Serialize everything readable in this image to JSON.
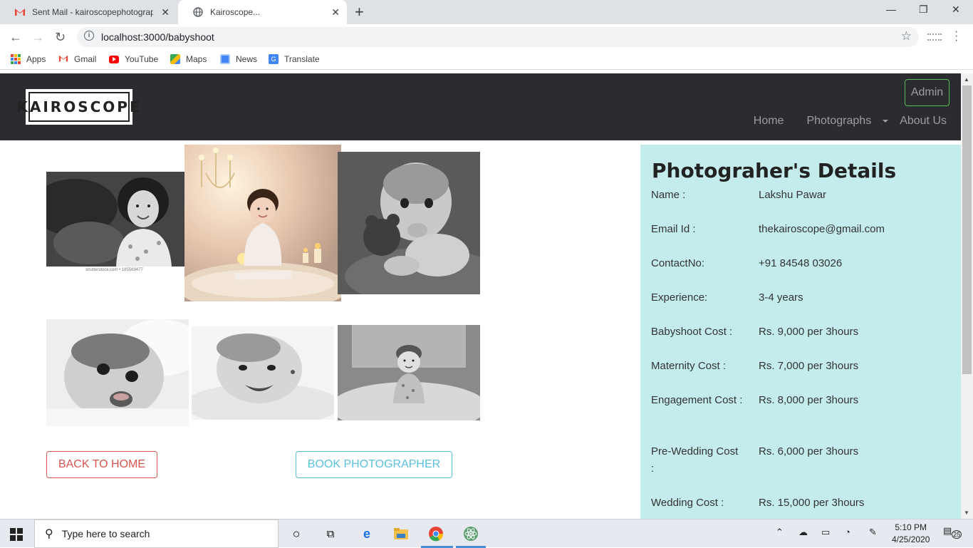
{
  "browser": {
    "tabs": [
      {
        "title": "Sent Mail - kairoscopephotographer",
        "icon": "gmail-icon"
      },
      {
        "title": "Kairoscope...",
        "icon": "globe-icon"
      }
    ],
    "url": "localhost:3000/babyshoot",
    "bookmarks": [
      {
        "label": "Apps",
        "icon": "apps-grid-icon",
        "color": "#ea4335"
      },
      {
        "label": "Gmail",
        "icon": "gmail-icon",
        "color": "#ea4335"
      },
      {
        "label": "YouTube",
        "icon": "youtube-icon",
        "color": "#ff0000"
      },
      {
        "label": "Maps",
        "icon": "maps-icon",
        "color": "#34a853"
      },
      {
        "label": "News",
        "icon": "news-icon",
        "color": "#4285f4"
      },
      {
        "label": "Translate",
        "icon": "translate-icon",
        "color": "#4285f4"
      }
    ]
  },
  "site": {
    "logo_text": "KAIROSCOPE",
    "admin_label": "Admin",
    "nav": {
      "home": "Home",
      "photographs": "Photographs",
      "about": "About Us"
    }
  },
  "gallery": {
    "photos": [
      {
        "alt": "smiling curly-haired girl, black and white"
      },
      {
        "alt": "baby sitting on fur rug with candles, color"
      },
      {
        "alt": "baby holding teddy bear, black and white"
      },
      {
        "alt": "laughing baby lying down, black and white"
      },
      {
        "alt": "smiling baby on blanket, black and white"
      },
      {
        "alt": "baby with knit hat lying on rug, black and white"
      }
    ],
    "caption": "shutterstock.com • 185569477"
  },
  "actions": {
    "back_label": "BACK TO HOME",
    "book_label": "BOOK PHOTOGRAPHER"
  },
  "details": {
    "title": "Photograher's Details",
    "rows": [
      {
        "label": "Name :",
        "value": "Lakshu Pawar"
      },
      {
        "label": "Email Id :",
        "value": "thekairoscope@gmail.com"
      },
      {
        "label": "ContactNo:",
        "value": "+91 84548 03026"
      },
      {
        "label": "Experience:",
        "value": "3-4 years"
      },
      {
        "label": "Babyshoot Cost :",
        "value": "Rs. 9,000 per 3hours"
      },
      {
        "label": "Maternity Cost :",
        "value": "Rs. 7,000 per 3hours"
      },
      {
        "label": "Engagement Cost :",
        "value": "Rs. 8,000 per 3hours"
      },
      {
        "label": "Pre-Wedding Cost :",
        "value": "Rs. 6,000 per 3hours"
      },
      {
        "label": "Wedding Cost :",
        "value": "Rs. 15,000 per 3hours"
      }
    ]
  },
  "taskbar": {
    "search_placeholder": "Type here to search",
    "time": "5:10 PM",
    "date": "4/25/2020",
    "notification_count": "25"
  },
  "colors": {
    "navbar_bg": "#2b2c2f",
    "details_bg": "#c4ecec",
    "danger": "#d9534f",
    "info": "#5bc0de",
    "success": "#5cb85c"
  }
}
